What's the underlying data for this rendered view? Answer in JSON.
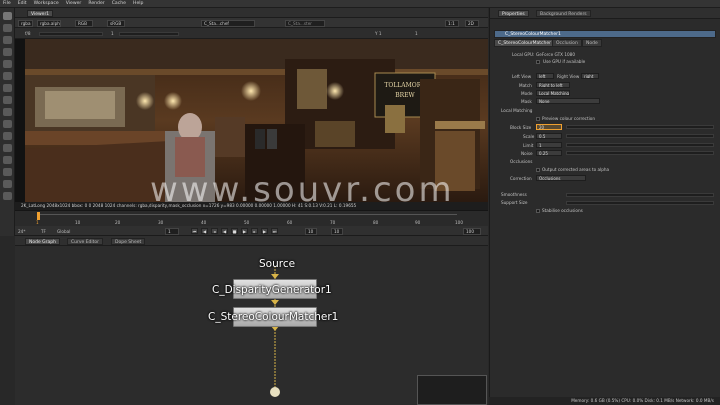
{
  "menu": [
    "File",
    "Edit",
    "Workspace",
    "Viewer",
    "Render",
    "Cache",
    "Help"
  ],
  "viewer_tab": "Viewer1",
  "viewer_toolbar": {
    "channels": "rgba",
    "layer": "rgba.alpha",
    "display": "RGB",
    "colorspace": "sRGB",
    "input_a": "C_Sta...chef",
    "input_b": "C_Sta...ster",
    "gain_label": "f/8",
    "gamma_value": "1",
    "zoom": "1:1",
    "view_mode": "2D",
    "gain_value": "0",
    "ypos": "Y 1",
    "wipe_value": "1"
  },
  "image_signs": {
    "pub_name_1": "TOLLAMORE",
    "pub_name_2": "BREW"
  },
  "watermark": "www.souvr.com",
  "info_bar": "2K_LatLong 2048x1024  bbox: 0 0 2048 1024  channels: rgba,disparity,mask_occlusion                x=1726 y=983          0.00000    0.00000    1.00000    H: 41 S:0.13 V:0.21 L: 0.19655",
  "timeline": {
    "ticks": [
      "1",
      "10",
      "20",
      "30",
      "40",
      "50",
      "60",
      "70",
      "80",
      "90",
      "100"
    ],
    "current_frame": "1"
  },
  "transport": {
    "fps": "24*",
    "tc_mode": "TF",
    "lut": "Global",
    "frame": "1",
    "step": "10",
    "step2": "10",
    "end_frame": "100"
  },
  "node_graph_tabs": [
    "Node Graph",
    "Curve Editor",
    "Dope Sheet"
  ],
  "nodes": {
    "source": "Source",
    "disparity": "C_DisparityGenerator1",
    "matcher": "C_StereoColourMatcher1"
  },
  "properties": {
    "tabs": [
      "Properties",
      "Background Renders"
    ],
    "node_title": "C_StereoColourMatcher1",
    "sub_tabs": [
      "C_StereoColourMatcher",
      "Occlusion",
      "Node"
    ],
    "local_gpu_label": "Local GPU:",
    "local_gpu_value": "GeForce GTX 1080",
    "use_gpu_label": "Use GPU if available",
    "left_view_label": "Left View",
    "left_view_value": "left",
    "right_view_label": "Right View",
    "right_view_value": "right",
    "match_label": "Match",
    "match_value": "Right to left",
    "mode_label": "Mode",
    "mode_value": "Local Matching",
    "mask_label": "Mask",
    "mask_value": "None",
    "local_matching_label": "Local Matching",
    "preview_label": "Preview colour correction",
    "block_size_label": "Block Size",
    "block_size_value": "20",
    "scale_label": "Scale",
    "scale_value": "0.5",
    "limit_label": "Limit",
    "limit_value": "1",
    "noise_label": "Noise",
    "noise_value": "0.25",
    "occlusions_label": "Occlusions",
    "output_occ_label": "Output corrected areas to alpha",
    "correction_label": "Correction",
    "correction_value": "Occlusions",
    "smoothness_label": "Smoothness",
    "support_size_label": "Support Size",
    "stabilise_label": "Stabilise occlusions"
  },
  "status": "Memory: 0.6 GB (0.5%)  CPU: 0.0%  Disk: 0.1 MB/s  Network: 0.0 MB/s",
  "colors": {
    "accent": "#f0a030",
    "selection": "#4d6a8a",
    "nodeYellow": "#d8b448"
  }
}
